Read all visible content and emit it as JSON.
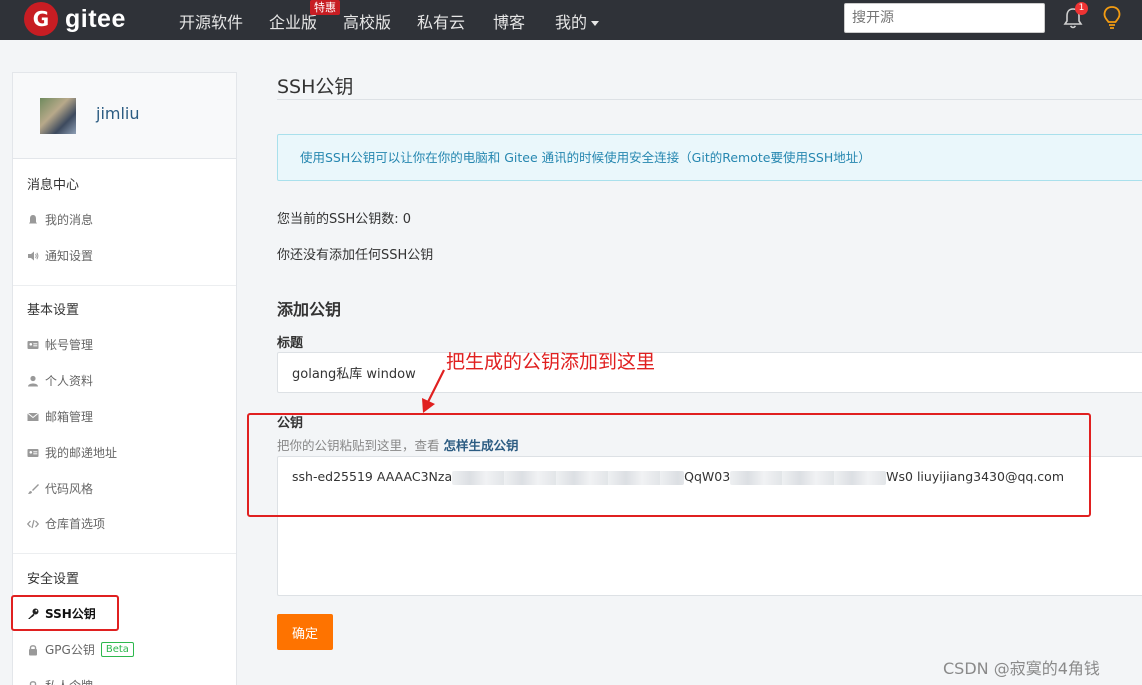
{
  "nav": {
    "logo_mark": "G",
    "logo_text": "gitee",
    "items": [
      "开源软件",
      "企业版",
      "高校版",
      "私有云",
      "博客",
      "我的"
    ],
    "badge": "特惠",
    "search_placeholder": "搜开源",
    "notification_count": "1"
  },
  "sidebar": {
    "username": "jimliu",
    "sections": [
      {
        "title": "消息中心",
        "items": [
          "我的消息",
          "通知设置"
        ]
      },
      {
        "title": "基本设置",
        "items": [
          "帐号管理",
          "个人资料",
          "邮箱管理",
          "我的邮递地址",
          "代码风格",
          "仓库首选项"
        ]
      },
      {
        "title": "安全设置",
        "items": [
          "SSH公钥",
          "GPG公钥",
          "私人令牌"
        ]
      }
    ],
    "active_item": "SSH公钥",
    "beta_label": "Beta"
  },
  "main": {
    "title": "SSH公钥",
    "info": "使用SSH公钥可以让你在你的电脑和 Gitee 通讯的时候使用安全连接（Git的Remote要使用SSH地址）",
    "key_count_text": "您当前的SSH公钥数: 0",
    "no_key_text": "你还没有添加任何SSH公钥",
    "add_heading": "添加公钥",
    "title_label": "标题",
    "title_value": "golang私库 window",
    "key_label": "公钥",
    "key_hint": "把你的公钥粘贴到这里，查看",
    "key_hint_link": "怎样生成公钥",
    "key_value_parts": [
      "ssh-ed25519 AAAAC3Nza",
      "QqW03",
      "Ws0 liuyijiang3430@qq.com"
    ],
    "submit_label": "确定"
  },
  "annotation": "把生成的公钥添加到这里",
  "watermark": "CSDN @寂寞的4角钱",
  "colors": {
    "nav_bg": "#2f3238",
    "brand_red": "#c71d23",
    "button_orange": "#fe7300",
    "annotation_red": "#e02020",
    "link_blue": "#2c5c82"
  }
}
